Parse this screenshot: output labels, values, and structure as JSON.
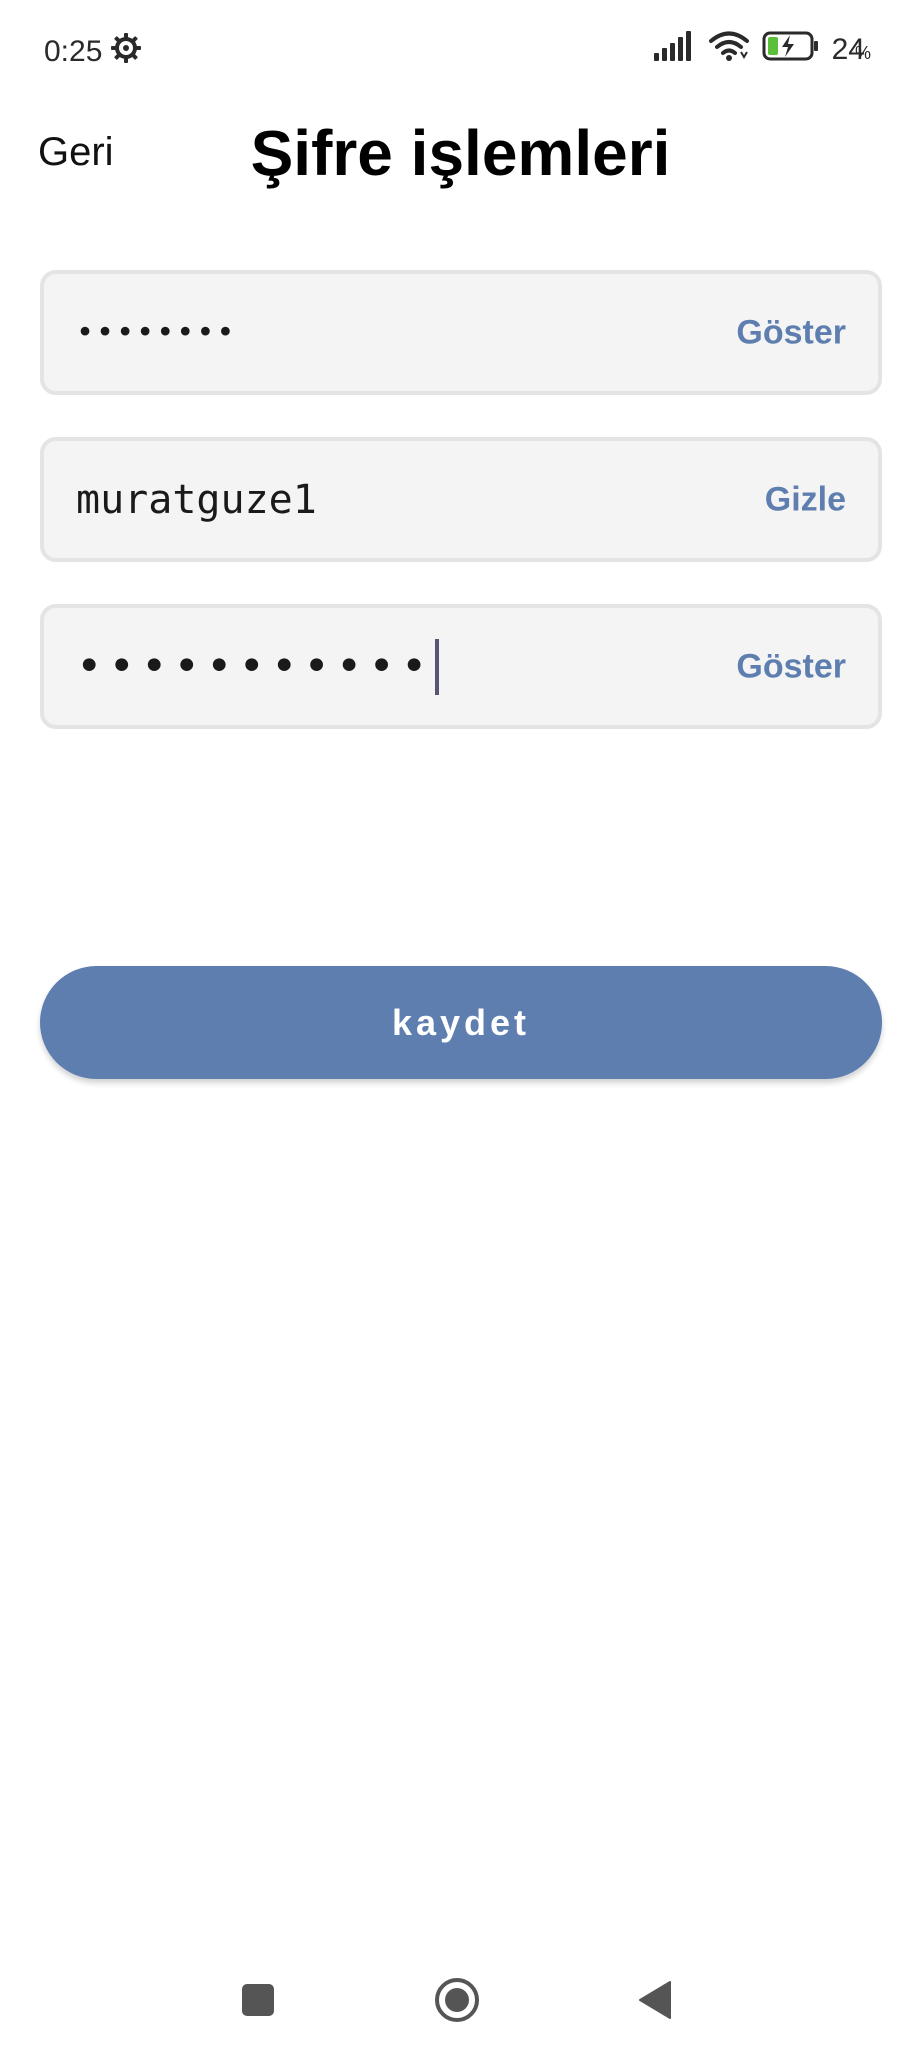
{
  "status_bar": {
    "time": "0:25",
    "settings_icon": "gear-icon",
    "signal_icon": "cellular-signal-icon",
    "wifi_icon": "wifi-icon",
    "battery_icon": "battery-charging-icon",
    "battery_percent": "24",
    "battery_percent_sign": "%",
    "battery_level": 0.24
  },
  "header": {
    "back_label": "Geri",
    "title": "Şifre işlemleri"
  },
  "fields": {
    "current_password": {
      "value": "••••••••",
      "toggle_label": "Göster"
    },
    "new_password": {
      "value": "muratguze1",
      "toggle_label": "Gizle"
    },
    "confirm_password": {
      "value": "•••••••••••",
      "toggle_label": "Göster"
    }
  },
  "save_button": {
    "label": "kaydet"
  },
  "navigation_bar": {
    "recents_icon": "square-recents-icon",
    "home_icon": "circle-home-icon",
    "back_icon": "triangle-back-icon"
  },
  "colors": {
    "accent": "#5e7eb0",
    "field_background": "#f4f4f5",
    "field_border": "#e4e4e6",
    "battery_fill": "#5bbf3a",
    "nav_icon": "#555555"
  }
}
